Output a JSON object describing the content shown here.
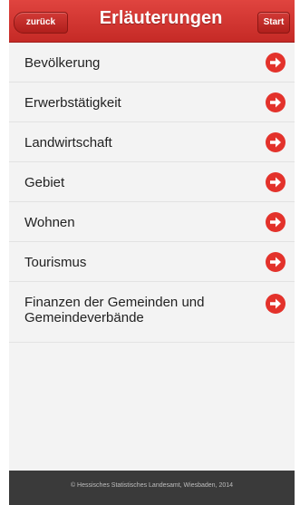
{
  "header": {
    "back_label": "zurück",
    "title": "Erläuterungen",
    "start_label": "Start"
  },
  "items": [
    {
      "label": "Bevölkerung"
    },
    {
      "label": "Erwerbstätigkeit"
    },
    {
      "label": "Landwirtschaft"
    },
    {
      "label": "Gebiet"
    },
    {
      "label": "Wohnen"
    },
    {
      "label": "Tourismus"
    },
    {
      "label": "Finanzen der Gemeinden und Gemeindeverbände"
    }
  ],
  "footer": {
    "text": "© Hessisches Statistisches Landesamt, Wiesbaden, 2014"
  },
  "colors": {
    "header": "#d4342f",
    "arrow": "#e3322b"
  },
  "icons": {
    "row_arrow": "arrow-right-circle-icon"
  }
}
